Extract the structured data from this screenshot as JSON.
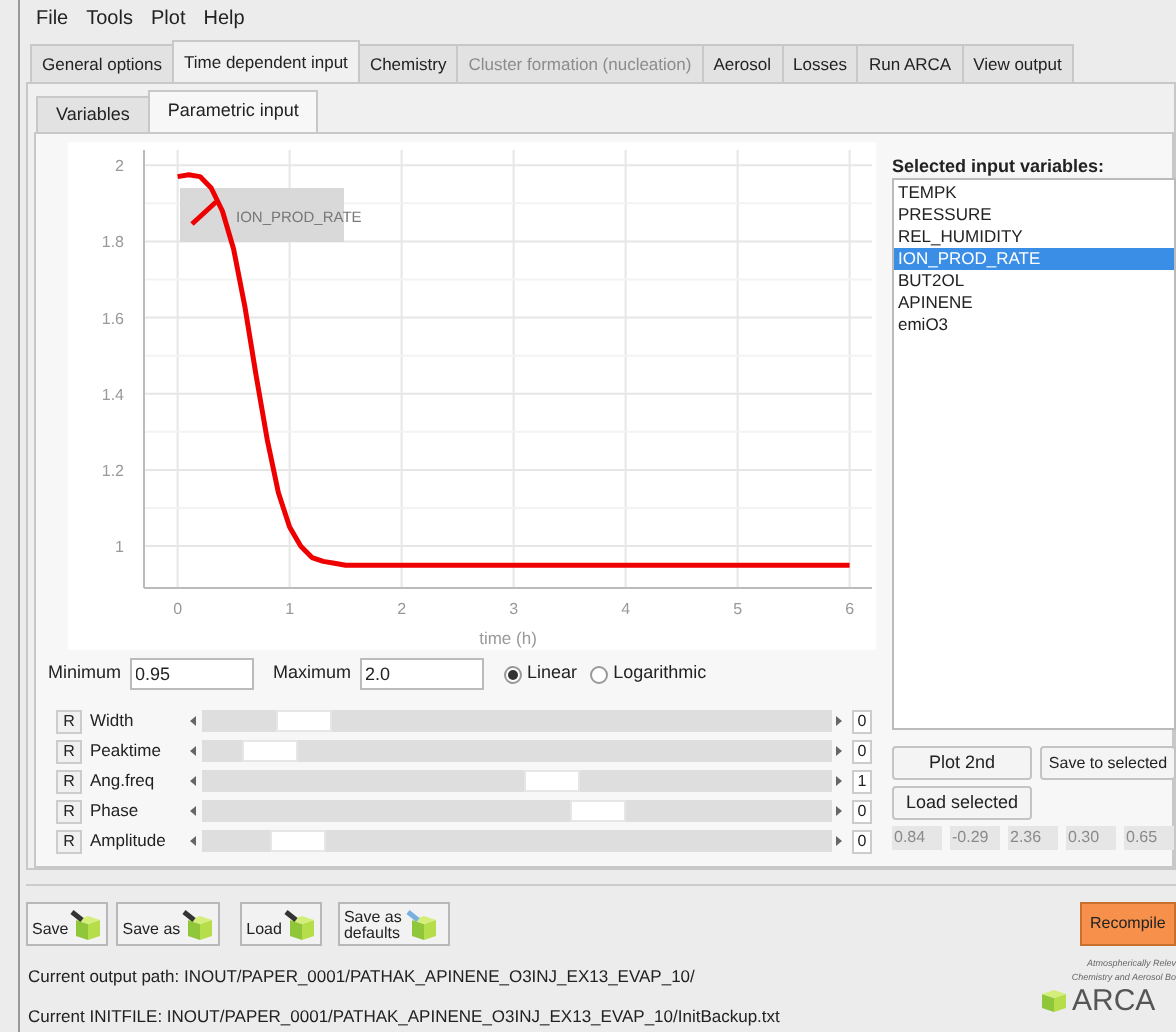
{
  "menu": [
    "File",
    "Tools",
    "Plot",
    "Help"
  ],
  "tabs": [
    {
      "label": "General options",
      "selected": false,
      "disabled": false
    },
    {
      "label": "Time dependent input",
      "selected": true,
      "disabled": false
    },
    {
      "label": "Chemistry",
      "selected": false,
      "disabled": false
    },
    {
      "label": "Cluster formation (nucleation)",
      "selected": false,
      "disabled": true
    },
    {
      "label": "Aerosol",
      "selected": false,
      "disabled": false
    },
    {
      "label": "Losses",
      "selected": false,
      "disabled": false
    },
    {
      "label": "Run ARCA",
      "selected": false,
      "disabled": false
    },
    {
      "label": "View output",
      "selected": false,
      "disabled": false
    }
  ],
  "subtabs": [
    {
      "label": "Variables",
      "selected": false
    },
    {
      "label": "Parametric input",
      "selected": true
    }
  ],
  "plot": {
    "chart_data": {
      "type": "line",
      "grid": true,
      "xlabel": "time (h)",
      "xlim": [
        -0.3,
        6.2
      ],
      "ylim": [
        0.89,
        2.04
      ],
      "xticks": [
        0,
        1,
        2,
        3,
        4,
        5,
        6
      ],
      "yticks": [
        1,
        1.2,
        1.4,
        1.6,
        1.8,
        2
      ],
      "x": [
        0,
        0.1,
        0.2,
        0.3,
        0.4,
        0.5,
        0.6,
        0.7,
        0.8,
        0.9,
        1,
        1.1,
        1.2,
        1.3,
        1.4,
        1.5,
        1.6,
        2,
        3,
        4,
        5,
        6
      ],
      "series": [
        {
          "name": "ION_PROD_RATE",
          "color": "#ee0000",
          "values": [
            1.97,
            1.975,
            1.97,
            1.94,
            1.88,
            1.78,
            1.63,
            1.45,
            1.28,
            1.14,
            1.05,
            1.0,
            0.97,
            0.96,
            0.955,
            0.95,
            0.95,
            0.95,
            0.95,
            0.95,
            0.95,
            0.95
          ]
        }
      ]
    }
  },
  "range": {
    "minimum_label": "Minimum",
    "minimum": "0.95",
    "maximum_label": "Maximum",
    "maximum": "2.0"
  },
  "scale": [
    {
      "label": "Linear",
      "selected": true
    },
    {
      "label": "Logarithmic",
      "selected": false
    }
  ],
  "sliders": [
    {
      "reset": "R",
      "name": "Width",
      "level": 0.13,
      "value": "0"
    },
    {
      "reset": "R",
      "name": "Peaktime",
      "level": 0.07,
      "value": "0"
    },
    {
      "reset": "R",
      "name": "Ang.freq",
      "level": 0.56,
      "value": "1"
    },
    {
      "reset": "R",
      "name": "Phase",
      "level": 0.64,
      "value": "0"
    },
    {
      "reset": "R",
      "name": "Amplitude",
      "level": 0.12,
      "value": "0"
    }
  ],
  "variables": {
    "title": "Selected input variables:",
    "items": [
      {
        "label": "TEMPK",
        "selected": false
      },
      {
        "label": "PRESSURE",
        "selected": false
      },
      {
        "label": "REL_HUMIDITY",
        "selected": false
      },
      {
        "label": "ION_PROD_RATE",
        "selected": true
      },
      {
        "label": "BUT2OL",
        "selected": false
      },
      {
        "label": "APINENE",
        "selected": false
      },
      {
        "label": "emiO3",
        "selected": false
      }
    ]
  },
  "actions": [
    "Plot 2nd",
    "Save to selected",
    "Load selected"
  ],
  "parameters": [
    "0.84",
    "-0.29",
    "2.36",
    "0.30",
    "0.65"
  ],
  "toolbar": [
    "Save",
    "Save as",
    "Load",
    "Save as defaults"
  ],
  "recompile": "Recompile",
  "status": [
    "Current output path: INOUT/PAPER_0001/PATHAK_APINENE_O3INJ_EX13_EVAP_10/",
    "Current INITFILE: INOUT/PAPER_0001/PATHAK_APINENE_O3INJ_EX13_EVAP_10/InitBackup.txt"
  ],
  "logo": {
    "line_1": "Atmospherically Relev",
    "line_2": "Chemistry and Aerosol Bo",
    "name": "ARCA"
  }
}
